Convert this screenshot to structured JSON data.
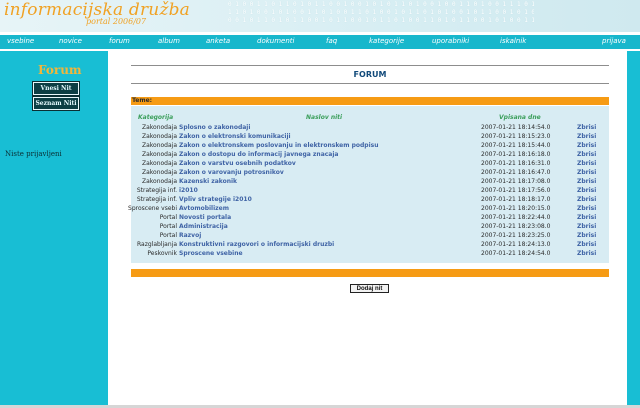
{
  "brand": {
    "title": "informacijska družba",
    "subtitle": "portal 2006/07",
    "binary_lines": [
      "0 1 0 0 1 1 0 1 1 0 1 0 1 1 0 0 1 0 0 1 0 1 0 1 1 0 1 0 0 1 0 0 1 1 0 1 0 0 1 1 1 0 1 0 1 0 0 1 0 1 0 0 1 1 0 1 0 0 0 1 0 1",
      "1 1 0 1 0 0 1 0 1 0 0 1 1 0 1 0 0 1 1 0 1 0 0 1 0 1 1 0 1 0 1 0 0 1 0 1 1 0 0 1 0 1 0 1 1 0 1 0 0 1 1 0 1 0 1 0 1 1 0 0",
      "0 0 1 0 1 1 0 1 0 1 1 0 0 1 0 1 1 0 0 1 0 1 1 0 1 0 0 1 1 0 1 0 1 1 0 0 1 0 1 0 0 1 1 0"
    ]
  },
  "nav": {
    "items": [
      "vsebine",
      "novice",
      "forum",
      "album",
      "anketa",
      "dokumenti",
      "faq",
      "kategorije",
      "uporabniki",
      "iskalnik",
      "prijava"
    ]
  },
  "sidebar": {
    "title": "Forum",
    "buttons": [
      "Vnesi Nit",
      "Seznam Niti"
    ],
    "status": "Niste prijavljeni"
  },
  "main": {
    "title": "FORUM",
    "section_label": "Teme:",
    "headers": {
      "kategorija": "Kategorija",
      "naslov": "Naslov niti",
      "vpisana": "Vpisana dne"
    },
    "rows": [
      {
        "kat": "Zakonodaja",
        "naslov": "Splosno o zakonodaji",
        "datum": "2007-01-21 18:14:54.0",
        "akcija": "Zbrisi"
      },
      {
        "kat": "Zakonodaja",
        "naslov": "Zakon o elektronski komunikaciji",
        "datum": "2007-01-21 18:15:23.0",
        "akcija": "Zbrisi"
      },
      {
        "kat": "Zakonodaja",
        "naslov": "Zakon o elektronskem poslovanju in elektronskem podpisu",
        "datum": "2007-01-21 18:15:44.0",
        "akcija": "Zbrisi"
      },
      {
        "kat": "Zakonodaja",
        "naslov": "Zakon o dostopu do informacij javnega znacaja",
        "datum": "2007-01-21 18:16:18.0",
        "akcija": "Zbrisi"
      },
      {
        "kat": "Zakonodaja",
        "naslov": "Zakon o varstvu osebnih podatkov",
        "datum": "2007-01-21 18:16:31.0",
        "akcija": "Zbrisi"
      },
      {
        "kat": "Zakonodaja",
        "naslov": "Zakon o varovanju potrosnikov",
        "datum": "2007-01-21 18:16:47.0",
        "akcija": "Zbrisi"
      },
      {
        "kat": "Zakonodaja",
        "naslov": "Kazenski zakonik",
        "datum": "2007-01-21 18:17:08.0",
        "akcija": "Zbrisi"
      },
      {
        "kat": "Strategija inf.",
        "naslov": "i2010",
        "datum": "2007-01-21 18:17:56.0",
        "akcija": "Zbrisi"
      },
      {
        "kat": "Strategija inf.",
        "naslov": "Vpliv strategije i2010",
        "datum": "2007-01-21 18:18:17.0",
        "akcija": "Zbrisi"
      },
      {
        "kat": "Sproscene vsebi",
        "naslov": "Avtomobilizem",
        "datum": "2007-01-21 18:20:15.0",
        "akcija": "Zbrisi"
      },
      {
        "kat": "Portal",
        "naslov": "Novosti portala",
        "datum": "2007-01-21 18:22:44.0",
        "akcija": "Zbrisi"
      },
      {
        "kat": "Portal",
        "naslov": "Administracija",
        "datum": "2007-01-21 18:23:08.0",
        "akcija": "Zbrisi"
      },
      {
        "kat": "Portal",
        "naslov": "Razvoj",
        "datum": "2007-01-21 18:23:25.0",
        "akcija": "Zbrisi"
      },
      {
        "kat": "Razglabljanja",
        "naslov": "Konstruktivni razgovori o informacijski druzbi",
        "datum": "2007-01-21 18:24:13.0",
        "akcija": "Zbrisi"
      },
      {
        "kat": "Peskovnik",
        "naslov": "Sproscene vsebine",
        "datum": "2007-01-21 18:24:54.0",
        "akcija": "Zbrisi"
      }
    ],
    "add_button": "Dodaj nit"
  },
  "colors": {
    "accent_teal": "#17b7cc",
    "accent_orange": "#f69b14",
    "link_blue": "#3f63a5",
    "header_green": "#3a9e5a"
  }
}
